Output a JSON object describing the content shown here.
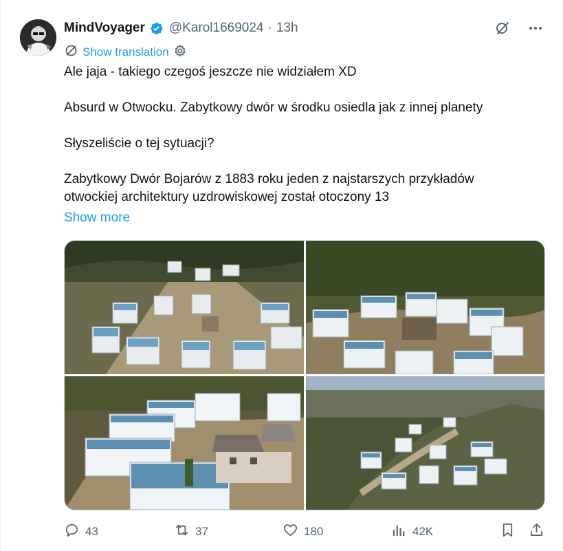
{
  "tweet": {
    "author": {
      "display_name": "MindVoyager",
      "handle": "@Karol1669024",
      "separator": "·",
      "time": "13h",
      "verified": true
    },
    "translate": {
      "label": "Show translation"
    },
    "text": {
      "p1": "Ale jaja - takiego czegoś jeszcze nie widziałem XD",
      "p2": "Absurd w Otwocku. Zabytkowy dwór w środku osiedla jak z innej planety",
      "p3": "Słyszeliście o tej sytuacji?",
      "p4a": "Zabytkowy Dwór Bojarów z 1883 roku jeden z najstarszych przykładów",
      "p4b": "otwockiej architektury uzdrowiskowej został otoczony 13"
    },
    "show_more": "Show more",
    "actions": {
      "replies": "43",
      "retweets": "37",
      "likes": "180",
      "views": "42K"
    },
    "icons": {
      "verified": "verified-badge-icon",
      "grok": "grok-icon",
      "more": "more-icon",
      "translate": "translate-icon",
      "settings": "settings-icon",
      "reply": "reply-icon",
      "retweet": "retweet-icon",
      "like": "heart-icon",
      "views": "views-icon",
      "bookmark": "bookmark-icon",
      "share": "share-icon"
    },
    "colors": {
      "accent": "#1d9bf0",
      "muted": "#536471",
      "text": "#0f1419"
    }
  }
}
